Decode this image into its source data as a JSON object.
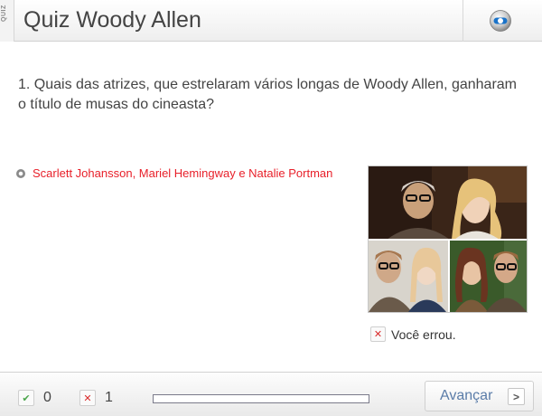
{
  "header": {
    "side_tag": "QUIZ",
    "title": "Quiz Woody Allen",
    "logo_icon": "globe-logo-icon"
  },
  "question": {
    "text": "1. Quais das atrizes, que estrelaram vários longas de Woody Allen, ganharam o título de musas do cineasta?"
  },
  "answer": {
    "selected_label": "Scarlett Johansson, Mariel Hemingway e Natalie Portman",
    "color": "#e8202a"
  },
  "image": {
    "alt": "Woody Allen com atrizes"
  },
  "feedback": {
    "icon": "wrong-icon",
    "text": "Você errou."
  },
  "footer": {
    "correct_count": "0",
    "wrong_count": "1",
    "progress_fraction": 0,
    "next_label": "Avançar",
    "next_icon": "chevron-right-icon"
  },
  "colors": {
    "accent_blue": "#5a7ca8",
    "error_red": "#d92b2b",
    "success_green": "#4ca64c"
  }
}
